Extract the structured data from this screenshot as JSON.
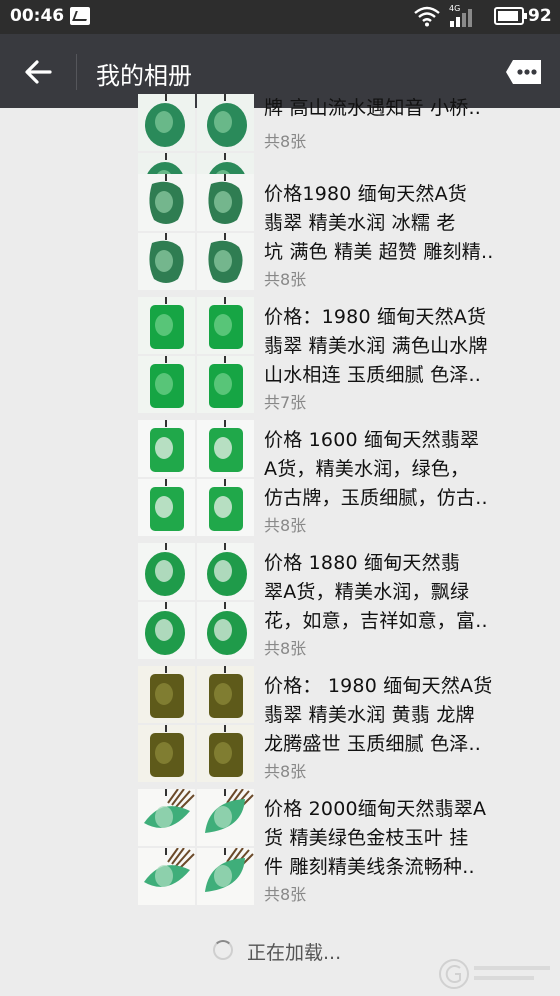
{
  "status_bar": {
    "time": "00:46",
    "network": "4G",
    "battery": "92",
    "icons": [
      "notification-icon",
      "wifi-icon",
      "signal-icon",
      "battery-icon"
    ]
  },
  "header": {
    "title": "我的相册",
    "back_icon": "arrow-left-icon",
    "more_icon": "chat-bubble-more-icon",
    "background": "#393a3f"
  },
  "albums": [
    {
      "lines": [
        "牌 高山流水遇知音 小桥.."
      ],
      "count": "共8张",
      "theme": "teal-round"
    },
    {
      "lines": [
        "价格1980 缅甸天然A货",
        "翡翠 精美水润 冰糯 老",
        "坑 满色 精美 超赞 雕刻精.."
      ],
      "count": "共8张",
      "theme": "green-carving"
    },
    {
      "lines": [
        "价格：1980 缅甸天然A货",
        "翡翠 精美水润 满色山水牌",
        "山水相连 玉质细腻 色泽.."
      ],
      "count": "共7张",
      "theme": "bright-green"
    },
    {
      "lines": [
        "价格 1600 缅甸天然翡翠",
        "A货，精美水润，绿色，",
        "仿古牌，玉质细腻，仿古.."
      ],
      "count": "共8张",
      "theme": "white-green-plaque"
    },
    {
      "lines": [
        "价格 1880 缅甸天然翡",
        "翠A货，精美水润，飘绿",
        "花，如意，吉祥如意，富.."
      ],
      "count": "共8张",
      "theme": "white-green-ruyi"
    },
    {
      "lines": [
        "价格： 1980 缅甸天然A货",
        "翡翠 精美水润 黄翡 龙牌",
        "龙腾盛世 玉质细腻 色泽.."
      ],
      "count": "共8张",
      "theme": "olive-dragon"
    },
    {
      "lines": [
        "价格 2000缅甸天然翡翠A",
        "货 精美绿色金枝玉叶 挂",
        "件 雕刻精美线条流畅种.."
      ],
      "count": "共8张",
      "theme": "green-leaf"
    }
  ],
  "loading": {
    "text": "正在加载...",
    "icon": "spinner-icon"
  },
  "watermark": {
    "icon": "site-logo-watermark"
  },
  "colors": {
    "jade_green": "#1f9a4a",
    "jade_light": "#cfe9d3",
    "olive": "#6f6a22",
    "leaf_green": "#3fae7a",
    "tassel": "#6b4a2a"
  }
}
